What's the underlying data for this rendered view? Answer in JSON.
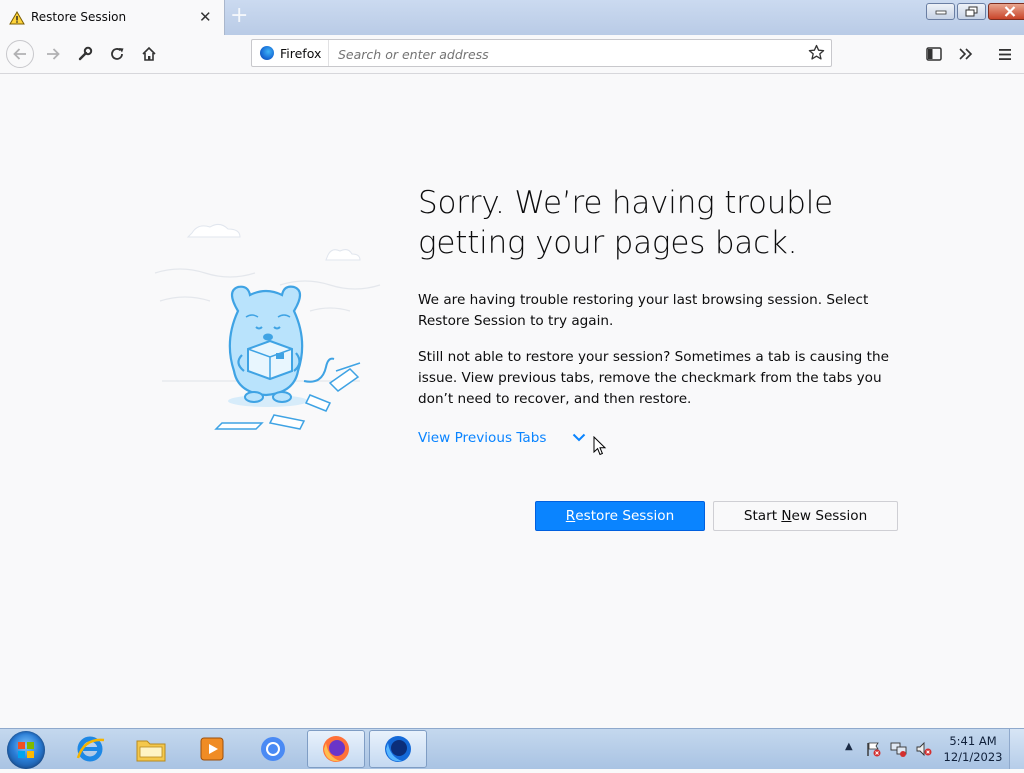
{
  "tab": {
    "title": "Restore Session",
    "icon": "warning-icon"
  },
  "navbar": {
    "identity_label": "Firefox",
    "url_placeholder": "Search or enter address"
  },
  "content": {
    "headline_line1": "Sorry. We’re having trouble",
    "headline_line2": "getting your pages back.",
    "para1": "We are having trouble restoring your last browsing session. Select Restore Session to try again.",
    "para2": "Still not able to restore your session? Sometimes a tab is causing the issue. View previous tabs, remove the checkmark from the tabs you don’t need to recover, and then restore.",
    "view_previous_tabs": "View Previous Tabs",
    "restore_button": {
      "pre": "",
      "underlined": "R",
      "post": "estore Session"
    },
    "new_session_button": {
      "pre": "Start ",
      "underlined": "N",
      "post": "ew Session"
    }
  },
  "taskbar": {
    "items": [
      "internet-explorer-icon",
      "file-explorer-icon",
      "media-player-icon",
      "chrome-icon",
      "firefox-icon",
      "firefox-developer-icon"
    ],
    "time": "5:41 AM",
    "date": "12/1/2023"
  },
  "colors": {
    "accent": "#0a84ff",
    "background": "#f9f9fa"
  }
}
